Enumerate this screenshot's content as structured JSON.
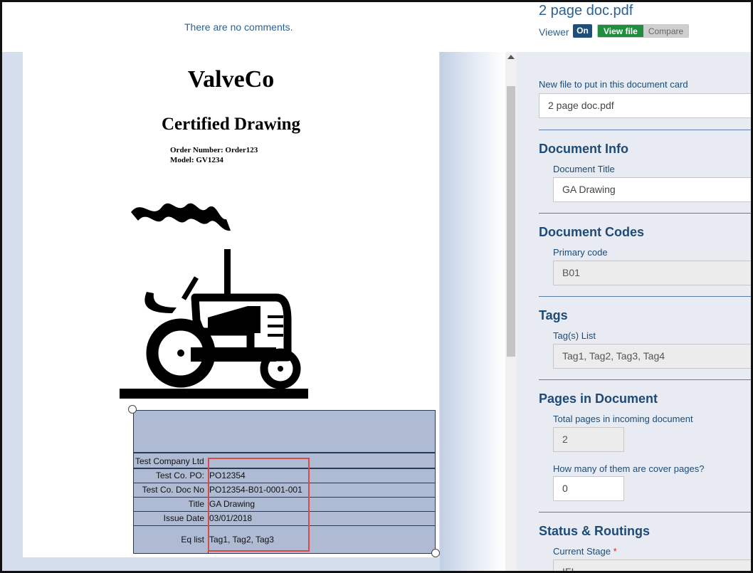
{
  "comments": {
    "empty_text": "There are no comments."
  },
  "file": {
    "name": "2 page doc.pdf"
  },
  "viewer": {
    "label": "Viewer",
    "toggle_state": "On",
    "view_file_label": "View file",
    "compare_label": "Compare"
  },
  "document": {
    "company": "ValveCo",
    "title": "Certified Drawing",
    "order_number": "Order Number: Order123",
    "model": "Model: GV1234",
    "stamp": {
      "company": "Test Company Ltd",
      "rows": [
        {
          "label": "Test Co. PO:",
          "value": "PO12354"
        },
        {
          "label": "Test Co. Doc No",
          "value": "PO12354-B01-0001-001"
        },
        {
          "label": "Title",
          "value": "GA Drawing"
        },
        {
          "label": "Issue Date",
          "value": "03/01/2018"
        },
        {
          "label": "Eq list",
          "value": "Tag1, Tag2, Tag3"
        }
      ]
    }
  },
  "form": {
    "new_file": {
      "label": "New file to put in this document card",
      "value": "2 page doc.pdf"
    },
    "document_info": {
      "heading": "Document Info",
      "title_label": "Document Title",
      "title_value": "GA Drawing"
    },
    "document_codes": {
      "heading": "Document Codes",
      "primary_code_label": "Primary code",
      "primary_code_value": "B01"
    },
    "tags": {
      "heading": "Tags",
      "list_label": "Tag(s) List",
      "list_value": "Tag1, Tag2, Tag3, Tag4"
    },
    "pages": {
      "heading": "Pages in Document",
      "total_label": "Total pages in incoming document",
      "total_value": "2",
      "cover_label": "How many of them are cover pages?",
      "cover_value": "0"
    },
    "status": {
      "heading": "Status & Routings",
      "stage_label": "Current Stage",
      "required_mark": "*",
      "stage_value": "IFI"
    }
  },
  "colors": {
    "accent": "#1e4b75",
    "view_file_green": "#1e8f3e",
    "highlight_red": "#d64a4a",
    "stamp_fill": "#aebbd2"
  }
}
